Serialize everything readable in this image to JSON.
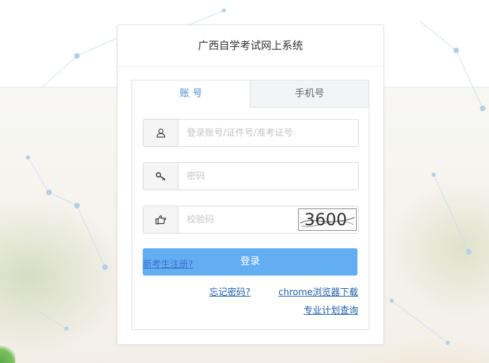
{
  "card": {
    "title": "广西自学考试网上系统"
  },
  "tabs": [
    {
      "label": "账 号",
      "active": true
    },
    {
      "label": "手机号",
      "active": false
    }
  ],
  "form": {
    "account": {
      "placeholder": "登录账号/证件号/准考证号",
      "value": "",
      "icon": "user-icon"
    },
    "password": {
      "placeholder": "密码",
      "value": "",
      "icon": "key-icon"
    },
    "captcha": {
      "placeholder": "校验码",
      "value": "",
      "icon": "hand-pointer-icon",
      "image_text": "3600"
    },
    "login_label": "登录",
    "register_label": "新考生注册?"
  },
  "links": {
    "forgot_password": "忘记密码?",
    "chrome_download": "chrome浏览器下载",
    "plan_query": "专业计划查询"
  },
  "colors": {
    "accent": "#4a90c9",
    "button": "#63adf2",
    "link": "#1f5fa8",
    "register_link": "#3a73c7"
  }
}
